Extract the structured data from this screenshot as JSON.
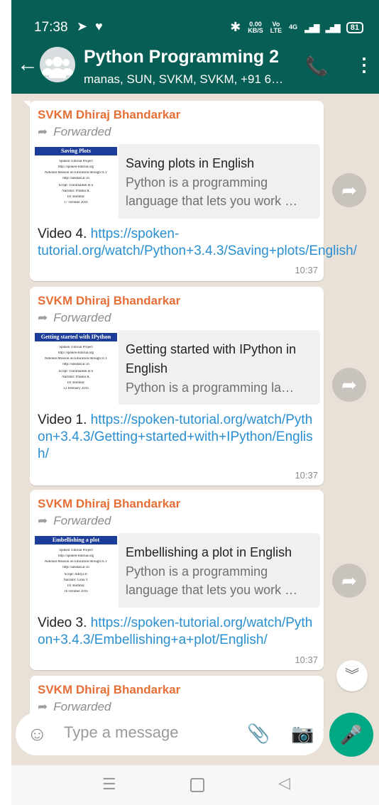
{
  "status_bar": {
    "time": "17:38",
    "net_speed_top": "0.00",
    "net_speed_bottom": "KB/S",
    "volte_top": "Vo",
    "volte_bottom": "LTE",
    "network_label": "4G",
    "battery": "81"
  },
  "chat": {
    "title": "Python Programming 2",
    "members": "manas, SUN, SVKM, SVKM, +91 6…"
  },
  "messages": [
    {
      "sender": "SVKM Dhiraj Bhandarkar",
      "forwarded": "Forwarded",
      "thumb_banner": "Saving Plots",
      "thumb_lines": [
        "Spoken Tutorial Project",
        "http://spoken-tutorial.org",
        "National Mission on Education through ICT",
        "http://sakshat.ac.in",
        "Script: Thirumalesh H S",
        "Narrator: Prabhu R.",
        "IIT Bombay",
        "17 October 2016"
      ],
      "preview_title": "Saving plots in English",
      "preview_desc": "Python is a programming language that lets you work …",
      "body_prefix": "Video 4. ",
      "link": "https://spoken-tutorial.org/watch/Python+3.4.3/Saving+plots/English/",
      "time": "10:37"
    },
    {
      "sender": "SVKM Dhiraj Bhandarkar",
      "forwarded": "Forwarded",
      "thumb_banner": "Getting started with IPython",
      "thumb_lines": [
        "Spoken Tutorial Project",
        "http://spoken-tutorial.org",
        "National Mission on Education through ICT",
        "http://sakshat.ac.in",
        "Script: Thirumalesh H S",
        "Narrator: Prabhu R.",
        "IIT Bombay",
        "12 February 2016"
      ],
      "preview_title": "Getting started with IPython in English",
      "preview_desc": "Python is a programming la…",
      "body_prefix": "Video 1. ",
      "link": "https://spoken-tutorial.org/watch/Python+3.4.3/Getting+started+with+IPython/English/",
      "time": "10:37"
    },
    {
      "sender": "SVKM Dhiraj Bhandarkar",
      "forwarded": "Forwarded",
      "thumb_banner": "Embellishing a plot",
      "thumb_lines": [
        "Spoken Tutorial Project",
        "http://spoken-tutorial.org",
        "National Mission on Education through ICT",
        "http://sakshat.ac.in",
        "Script: Aditya P.",
        "Narrator: Usha V.",
        "IIT Bombay",
        "16 October 2016"
      ],
      "preview_title": "Embellishing a plot in English",
      "preview_desc": "Python is a programming language that lets you work …",
      "body_prefix": "Video 3. ",
      "link": "https://spoken-tutorial.org/watch/Python+3.4.3/Embellishing+a+plot/English/",
      "time": "10:37"
    },
    {
      "sender": "SVKM Dhiraj Bhandarkar",
      "forwarded": "Forwarded"
    }
  ],
  "composer": {
    "placeholder": "Type a message"
  },
  "icons": {
    "back": "arrow-left-icon",
    "group_avatar": "group-avatar-icon",
    "add_call": "add-call-icon",
    "more": "more-vertical-icon",
    "forward": "forward-icon",
    "scroll_down": "double-chevron-down-icon",
    "emoji": "emoji-icon",
    "attach": "paperclip-icon",
    "camera": "camera-icon",
    "mic": "microphone-icon"
  },
  "colors": {
    "header": "#075e54",
    "sender": "#e56f37",
    "link": "#2a8fd0",
    "mic_button": "#00a884",
    "chat_bg": "#e9e1d8"
  }
}
